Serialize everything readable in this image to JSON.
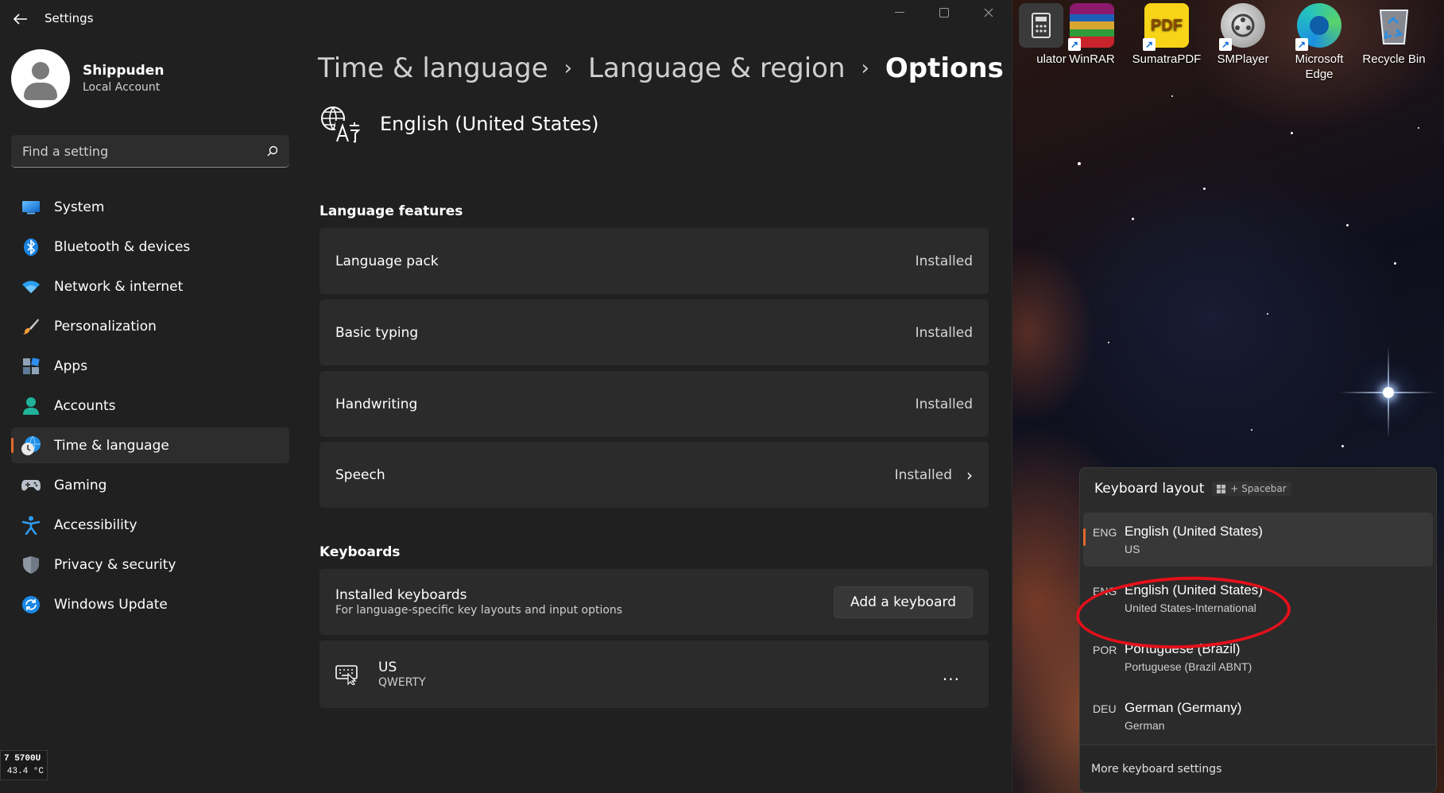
{
  "window": {
    "app_title": "Settings"
  },
  "profile": {
    "name": "Shippuden",
    "account_type": "Local Account"
  },
  "search": {
    "placeholder": "Find a setting"
  },
  "nav": {
    "items": [
      {
        "label": "System",
        "icon": "system-icon"
      },
      {
        "label": "Bluetooth & devices",
        "icon": "bluetooth-icon"
      },
      {
        "label": "Network & internet",
        "icon": "wifi-icon"
      },
      {
        "label": "Personalization",
        "icon": "brush-icon"
      },
      {
        "label": "Apps",
        "icon": "apps-icon"
      },
      {
        "label": "Accounts",
        "icon": "person-icon"
      },
      {
        "label": "Time & language",
        "icon": "globe-clock-icon",
        "active": true
      },
      {
        "label": "Gaming",
        "icon": "controller-icon"
      },
      {
        "label": "Accessibility",
        "icon": "accessibility-icon"
      },
      {
        "label": "Privacy & security",
        "icon": "shield-icon"
      },
      {
        "label": "Windows Update",
        "icon": "update-icon"
      }
    ]
  },
  "breadcrumb": {
    "level1": "Time & language",
    "level2": "Language & region",
    "current": "Options"
  },
  "language": {
    "title": "English (United States)",
    "icon": "language-icon"
  },
  "language_features": {
    "heading": "Language features",
    "items": [
      {
        "label": "Language pack",
        "status": "Installed"
      },
      {
        "label": "Basic typing",
        "status": "Installed"
      },
      {
        "label": "Handwriting",
        "status": "Installed"
      },
      {
        "label": "Speech",
        "status": "Installed"
      }
    ]
  },
  "keyboards": {
    "heading": "Keyboards",
    "installed_title": "Installed keyboards",
    "installed_desc": "For language-specific key layouts and input options",
    "add_button": "Add a keyboard",
    "keyboard": {
      "name": "US",
      "layout": "QWERTY",
      "more": "..."
    }
  },
  "cpu_badge": {
    "line1": "7 5700U",
    "line2": "43.4 °C"
  },
  "desktop": {
    "icons": [
      {
        "label": "ulator",
        "icon": "calculator-icon"
      },
      {
        "label": "WinRAR",
        "icon": "winrar-icon"
      },
      {
        "label": "SumatraPDF",
        "icon": "pdf-icon"
      },
      {
        "label": "SMPlayer",
        "icon": "smplayer-icon"
      },
      {
        "label": "Microsoft Edge",
        "icon": "edge-icon"
      },
      {
        "label": "Recycle Bin",
        "icon": "recycle-bin-icon"
      }
    ]
  },
  "flyout": {
    "title": "Keyboard layout",
    "hint": "+ Spacebar",
    "items": [
      {
        "code": "ENG",
        "name": "English (United States)",
        "sub": "US",
        "selected": true
      },
      {
        "code": "ENG",
        "name": "English (United States)",
        "sub": "United States-International"
      },
      {
        "code": "POR",
        "name": "Portuguese (Brazil)",
        "sub": "Portuguese (Brazil ABNT)"
      },
      {
        "code": "DEU",
        "name": "German (Germany)",
        "sub": "German"
      }
    ],
    "footer": "More keyboard settings"
  },
  "colors": {
    "accent": "#e36b2c",
    "window_bg": "#202020",
    "card_bg": "#2b2b2b",
    "annotation": "#e4101a"
  }
}
